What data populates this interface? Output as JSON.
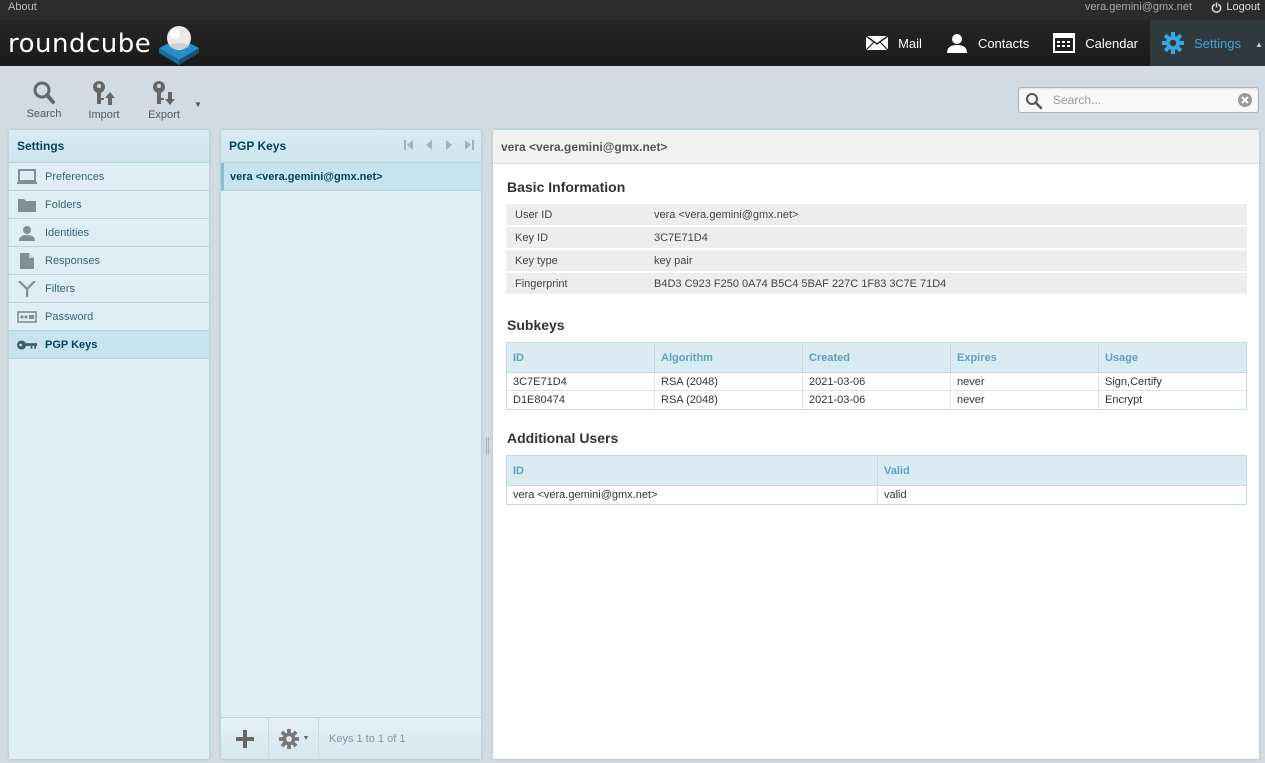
{
  "topline": {
    "about": "About",
    "user_email": "vera.gemini@gmx.net",
    "logout": "Logout"
  },
  "brand": {
    "logo_text": "roundcube"
  },
  "tasks": [
    {
      "label": "Mail",
      "icon": "mail-icon"
    },
    {
      "label": "Contacts",
      "icon": "contacts-icon"
    },
    {
      "label": "Calendar",
      "icon": "calendar-icon"
    },
    {
      "label": "Settings",
      "icon": "gear-icon",
      "active": true
    }
  ],
  "toolbar": {
    "search": "Search",
    "import": "Import",
    "export": "Export"
  },
  "search": {
    "placeholder": "Search...",
    "value": ""
  },
  "settings": {
    "title": "Settings",
    "items": [
      {
        "label": "Preferences",
        "icon": "monitor-icon"
      },
      {
        "label": "Folders",
        "icon": "folder-icon"
      },
      {
        "label": "Identities",
        "icon": "person-icon"
      },
      {
        "label": "Responses",
        "icon": "document-icon"
      },
      {
        "label": "Filters",
        "icon": "filter-icon"
      },
      {
        "label": "Password",
        "icon": "password-icon"
      },
      {
        "label": "PGP Keys",
        "icon": "key-icon",
        "active": true
      }
    ]
  },
  "keys": {
    "title": "PGP Keys",
    "items": [
      {
        "label": "vera <vera.gemini@gmx.net>",
        "selected": true
      }
    ],
    "count_text": "Keys 1 to 1 of 1"
  },
  "detail": {
    "title": "vera <vera.gemini@gmx.net>",
    "basic_title": "Basic Information",
    "basic": [
      {
        "key": "User ID",
        "value": "vera <vera.gemini@gmx.net>"
      },
      {
        "key": "Key ID",
        "value": "3C7E71D4"
      },
      {
        "key": "Key type",
        "value": "key pair"
      },
      {
        "key": "Fingerprint",
        "value": "B4D3 C923 F250 0A74 B5C4 5BAF 227C 1F83 3C7E 71D4"
      }
    ],
    "subkeys_title": "Subkeys",
    "subkeys_headers": [
      "ID",
      "Algorithm",
      "Created",
      "Expires",
      "Usage"
    ],
    "subkeys": [
      [
        "3C7E71D4",
        "RSA (2048)",
        "2021-03-06",
        "never",
        "Sign,Certify"
      ],
      [
        "D1E80474",
        "RSA (2048)",
        "2021-03-06",
        "never",
        "Encrypt"
      ]
    ],
    "users_title": "Additional Users",
    "users_headers": [
      "ID",
      "Valid"
    ],
    "users": [
      [
        "vera <vera.gemini@gmx.net>",
        "valid"
      ]
    ]
  },
  "colors": {
    "accent": "#37a6e4",
    "header_bg": "#1f1f1f",
    "panel_bg": "#dfeef5",
    "selected_bg": "#c7e3ef"
  }
}
